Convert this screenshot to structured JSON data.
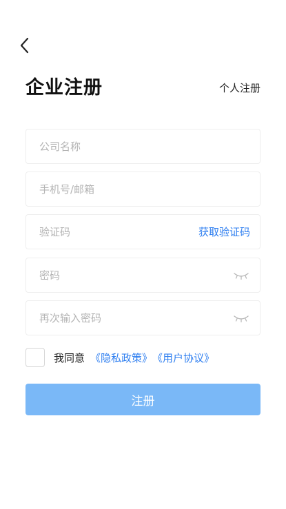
{
  "header": {
    "back_icon": "chevron-left-icon",
    "title": "企业注册",
    "switch_label": "个人注册"
  },
  "form": {
    "company_name": {
      "value": "",
      "placeholder": "公司名称"
    },
    "account": {
      "value": "",
      "placeholder": "手机号/邮箱"
    },
    "code": {
      "value": "",
      "placeholder": "验证码",
      "action_label": "获取验证码"
    },
    "password": {
      "value": "",
      "placeholder": "密码",
      "toggle_icon": "eye-closed-icon"
    },
    "confirm_password": {
      "value": "",
      "placeholder": "再次输入密码",
      "toggle_icon": "eye-closed-icon"
    }
  },
  "agreement": {
    "checked": false,
    "text": "我同意",
    "privacy_link": "《隐私政策》",
    "terms_link": "《用户协议》"
  },
  "submit": {
    "label": "注册"
  },
  "colors": {
    "accent": "#2f7ff0",
    "button_disabled": "#7ab8f7",
    "placeholder": "#b3b3b3",
    "border": "#eeeeee"
  }
}
